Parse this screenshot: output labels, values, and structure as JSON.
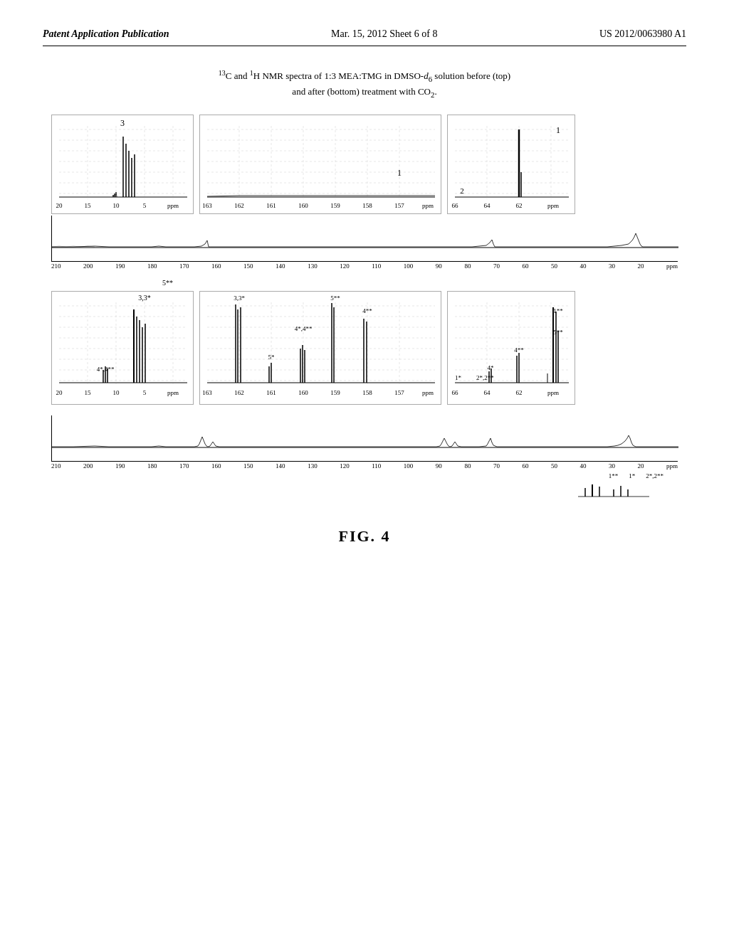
{
  "header": {
    "left": "Patent Application Publication",
    "center": "Mar. 15, 2012  Sheet 6 of 8",
    "right": "US 2012/0063980 A1"
  },
  "figure_title": {
    "line1": "¹³C and ¹H NMR spectra of 1:3 MEA:TMG in DMSO-d₆ solution before (top)",
    "line2": "and after (bottom) treatment with CO₂."
  },
  "top_chart": {
    "inset1": {
      "label": "3",
      "x_labels": [
        "20",
        "15",
        "10",
        "5",
        "ppm"
      ]
    },
    "inset2": {
      "label": "1",
      "x_labels": [
        "163",
        "162",
        "161",
        "160",
        "159",
        "158",
        "157",
        "ppm"
      ]
    },
    "inset3": {
      "label": "1",
      "sub_label": "2",
      "x_labels": [
        "66",
        "64",
        "62",
        "ppm"
      ]
    },
    "full_x_labels": [
      "210",
      "200",
      "190",
      "180",
      "170",
      "160",
      "150",
      "140",
      "130",
      "120",
      "110",
      "100",
      "90",
      "80",
      "70",
      "60",
      "50",
      "40",
      "30",
      "20",
      "ppm"
    ]
  },
  "bottom_chart": {
    "inset1": {
      "label": "3,3*",
      "sub_label": "4*,4**",
      "x_labels": [
        "20",
        "15",
        "10",
        "5",
        "ppm"
      ]
    },
    "inset2": {
      "labels": [
        "5**",
        "3,3*",
        "4*,4**",
        "5*"
      ],
      "x_labels": [
        "163",
        "162",
        "161",
        "160",
        "159",
        "158",
        "157",
        "ppm"
      ]
    },
    "inset3": {
      "labels": [
        "5**",
        "4**",
        "4*",
        "1**",
        "1*",
        "2*,2**"
      ],
      "x_labels": [
        "66",
        "64",
        "62",
        "ppm"
      ]
    },
    "full_x_labels": [
      "210",
      "200",
      "190",
      "180",
      "170",
      "160",
      "150",
      "140",
      "130",
      "120",
      "110",
      "100",
      "90",
      "80",
      "70",
      "60",
      "50",
      "40",
      "30",
      "20",
      "ppm"
    ]
  },
  "figure_label": "FIG. 4"
}
